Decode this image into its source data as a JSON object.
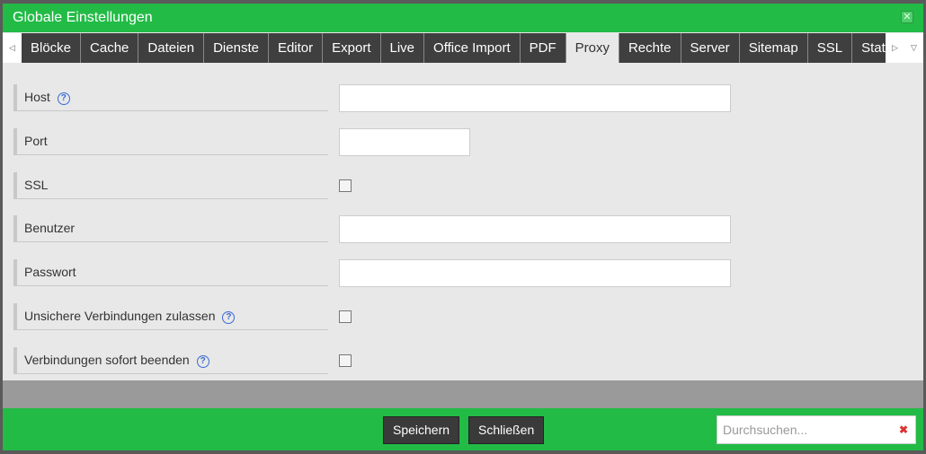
{
  "title": "Globale Einstellungen",
  "tabs": [
    "Blöcke",
    "Cache",
    "Dateien",
    "Dienste",
    "Editor",
    "Export",
    "Live",
    "Office Import",
    "PDF",
    "Proxy",
    "Rechte",
    "Server",
    "Sitemap",
    "SSL",
    "Statist"
  ],
  "active_tab": "Proxy",
  "fields": [
    {
      "label": "Host",
      "help": true,
      "type": "text",
      "value": ""
    },
    {
      "label": "Port",
      "help": false,
      "type": "short",
      "value": ""
    },
    {
      "label": "SSL",
      "help": false,
      "type": "checkbox",
      "checked": false
    },
    {
      "label": "Benutzer",
      "help": false,
      "type": "text",
      "value": ""
    },
    {
      "label": "Passwort",
      "help": false,
      "type": "text",
      "value": ""
    },
    {
      "label": "Unsichere Verbindungen zulassen",
      "help": true,
      "type": "checkbox",
      "checked": false
    },
    {
      "label": "Verbindungen sofort beenden",
      "help": true,
      "type": "checkbox",
      "checked": false
    }
  ],
  "footer": {
    "save": "Speichern",
    "close": "Schließen",
    "search_placeholder": "Durchsuchen..."
  },
  "colors": {
    "accent": "#22bb46",
    "tab_bg": "#3f3f3f"
  }
}
